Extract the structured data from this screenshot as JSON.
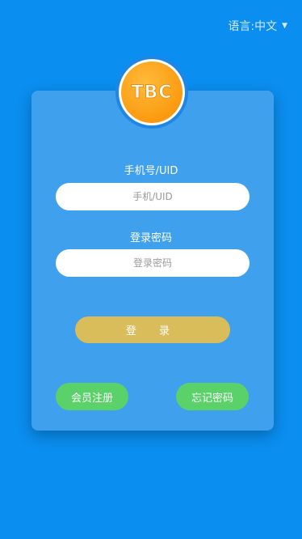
{
  "language": {
    "label": "语言:",
    "value": "中文",
    "caret_icon": "caret-down-icon"
  },
  "logo": {
    "text": "TBC",
    "colors": {
      "outer": "#fb9a10",
      "ring": "#ffffff",
      "border": "#1f86e6"
    }
  },
  "form": {
    "phone_label": "手机号/UID",
    "phone_placeholder": "手机/UID",
    "password_label": "登录密码",
    "password_placeholder": "登录密码",
    "login_label": "登 录"
  },
  "footer": {
    "register_label": "会员注册",
    "forgot_label": "忘记密码"
  },
  "colors": {
    "background": "#0a8ef0",
    "card": "#3fa0ee",
    "login_button": "#d9bd5b",
    "secondary_buttons": "#5bd16a"
  }
}
